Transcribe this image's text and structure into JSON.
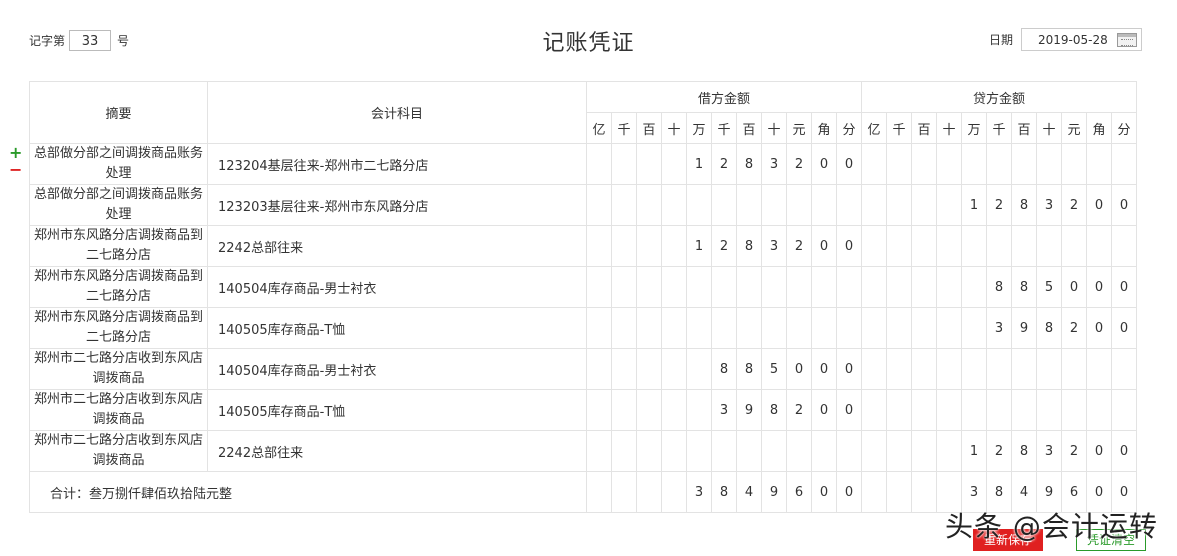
{
  "header": {
    "voucher_prefix": "记字第",
    "voucher_number": "33",
    "voucher_suffix": "号",
    "title": "记账凭证",
    "date_label": "日期",
    "date_value": "2019-05-28"
  },
  "table": {
    "col_summary": "摘要",
    "col_account": "会计科目",
    "debit_header": "借方金额",
    "credit_header": "贷方金额",
    "digit_units": [
      "亿",
      "千",
      "百",
      "十",
      "万",
      "千",
      "百",
      "十",
      "元",
      "角",
      "分"
    ],
    "rows": [
      {
        "summary": "总部做分部之间调拨商品账务处理",
        "account": "123204基层往来-郑州市二七路分店",
        "debit": [
          "",
          "",
          "",
          "",
          "1",
          "2",
          "8",
          "3",
          "2",
          "0",
          "0"
        ],
        "credit": [
          "",
          "",
          "",
          "",
          "",
          "",
          "",
          "",
          "",
          "",
          ""
        ]
      },
      {
        "summary": "总部做分部之间调拨商品账务处理",
        "account": "123203基层往来-郑州市东风路分店",
        "debit": [
          "",
          "",
          "",
          "",
          "",
          "",
          "",
          "",
          "",
          "",
          ""
        ],
        "credit": [
          "",
          "",
          "",
          "",
          "1",
          "2",
          "8",
          "3",
          "2",
          "0",
          "0"
        ]
      },
      {
        "summary": "郑州市东风路分店调拨商品到二七路分店",
        "account": "2242总部往来",
        "debit": [
          "",
          "",
          "",
          "",
          "1",
          "2",
          "8",
          "3",
          "2",
          "0",
          "0"
        ],
        "credit": [
          "",
          "",
          "",
          "",
          "",
          "",
          "",
          "",
          "",
          "",
          ""
        ]
      },
      {
        "summary": "郑州市东风路分店调拨商品到二七路分店",
        "account": "140504库存商品-男士衬衣",
        "debit": [
          "",
          "",
          "",
          "",
          "",
          "",
          "",
          "",
          "",
          "",
          ""
        ],
        "credit": [
          "",
          "",
          "",
          "",
          "",
          "8",
          "8",
          "5",
          "0",
          "0",
          "0"
        ]
      },
      {
        "summary": "郑州市东风路分店调拨商品到二七路分店",
        "account": "140505库存商品-T恤",
        "debit": [
          "",
          "",
          "",
          "",
          "",
          "",
          "",
          "",
          "",
          "",
          ""
        ],
        "credit": [
          "",
          "",
          "",
          "",
          "",
          "3",
          "9",
          "8",
          "2",
          "0",
          "0"
        ]
      },
      {
        "summary": "郑州市二七路分店收到东风店调拨商品",
        "account": "140504库存商品-男士衬衣",
        "debit": [
          "",
          "",
          "",
          "",
          "",
          "8",
          "8",
          "5",
          "0",
          "0",
          "0"
        ],
        "credit": [
          "",
          "",
          "",
          "",
          "",
          "",
          "",
          "",
          "",
          "",
          ""
        ]
      },
      {
        "summary": "郑州市二七路分店收到东风店调拨商品",
        "account": "140505库存商品-T恤",
        "debit": [
          "",
          "",
          "",
          "",
          "",
          "3",
          "9",
          "8",
          "2",
          "0",
          "0"
        ],
        "credit": [
          "",
          "",
          "",
          "",
          "",
          "",
          "",
          "",
          "",
          "",
          ""
        ]
      },
      {
        "summary": "郑州市二七路分店收到东风店调拨商品",
        "account": "2242总部往来",
        "debit": [
          "",
          "",
          "",
          "",
          "",
          "",
          "",
          "",
          "",
          "",
          ""
        ],
        "credit": [
          "",
          "",
          "",
          "",
          "1",
          "2",
          "8",
          "3",
          "2",
          "0",
          "0"
        ]
      }
    ],
    "total": {
      "label": "合计：叁万捌仟肆佰玖拾陆元整",
      "debit": [
        "",
        "",
        "",
        "",
        "3",
        "8",
        "4",
        "9",
        "6",
        "0",
        "0"
      ],
      "credit": [
        "",
        "",
        "",
        "",
        "3",
        "8",
        "4",
        "9",
        "6",
        "0",
        "0"
      ]
    }
  },
  "actions": {
    "save_label": "重新保存",
    "clear_label": "凭证清空"
  },
  "watermark": "头条 @会计运转",
  "colors": {
    "add": "#2a9a2a",
    "remove": "#dd2222",
    "save_button": "#e02020"
  }
}
